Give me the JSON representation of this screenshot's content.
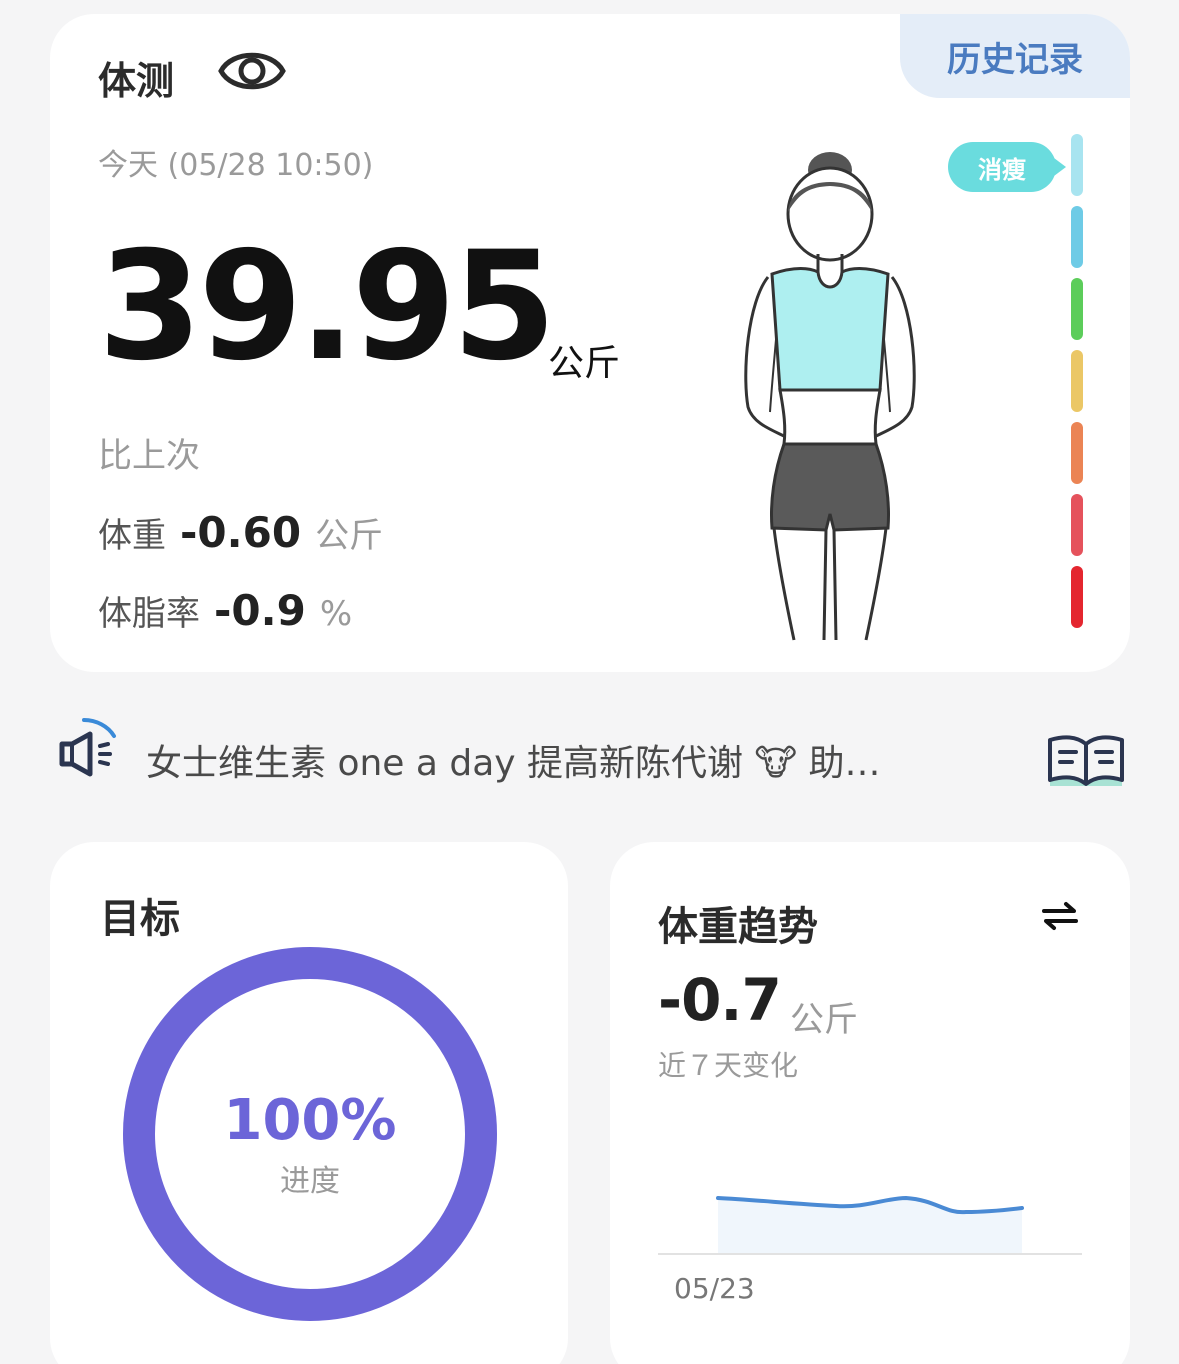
{
  "body_card": {
    "history_label": "历史记录",
    "title": "体测",
    "date": "今天 (05/28 10:50)",
    "weight": "39.95",
    "weight_unit": "公斤",
    "compare_label": "比上次",
    "weight_change": {
      "label": "体重",
      "value": "-0.60",
      "unit": "公斤"
    },
    "fat_change": {
      "label": "体脂率",
      "value": "-0.9",
      "unit": "%"
    },
    "scale_badge": "消瘦",
    "scale_colors": [
      "#a8e4f0",
      "#6ecbe6",
      "#5ccd5a",
      "#ebc766",
      "#eb8454",
      "#e5525c",
      "#e4262f"
    ]
  },
  "announcement": {
    "text": "女士维生素 one a day 提高新陈代谢 🐮 助…",
    "icons": [
      "speaker-icon",
      "book-icon"
    ]
  },
  "goal": {
    "title": "目标",
    "percent_text": "100%",
    "progress": 1.0,
    "label": "进度",
    "color": "#6c65d8"
  },
  "trend": {
    "title": "体重趋势",
    "value": "-0.7",
    "unit": "公斤",
    "subtitle": "近７天变化",
    "x_label": "05/23",
    "icon": "swap-icon",
    "line_color": "#4a8ad4"
  }
}
